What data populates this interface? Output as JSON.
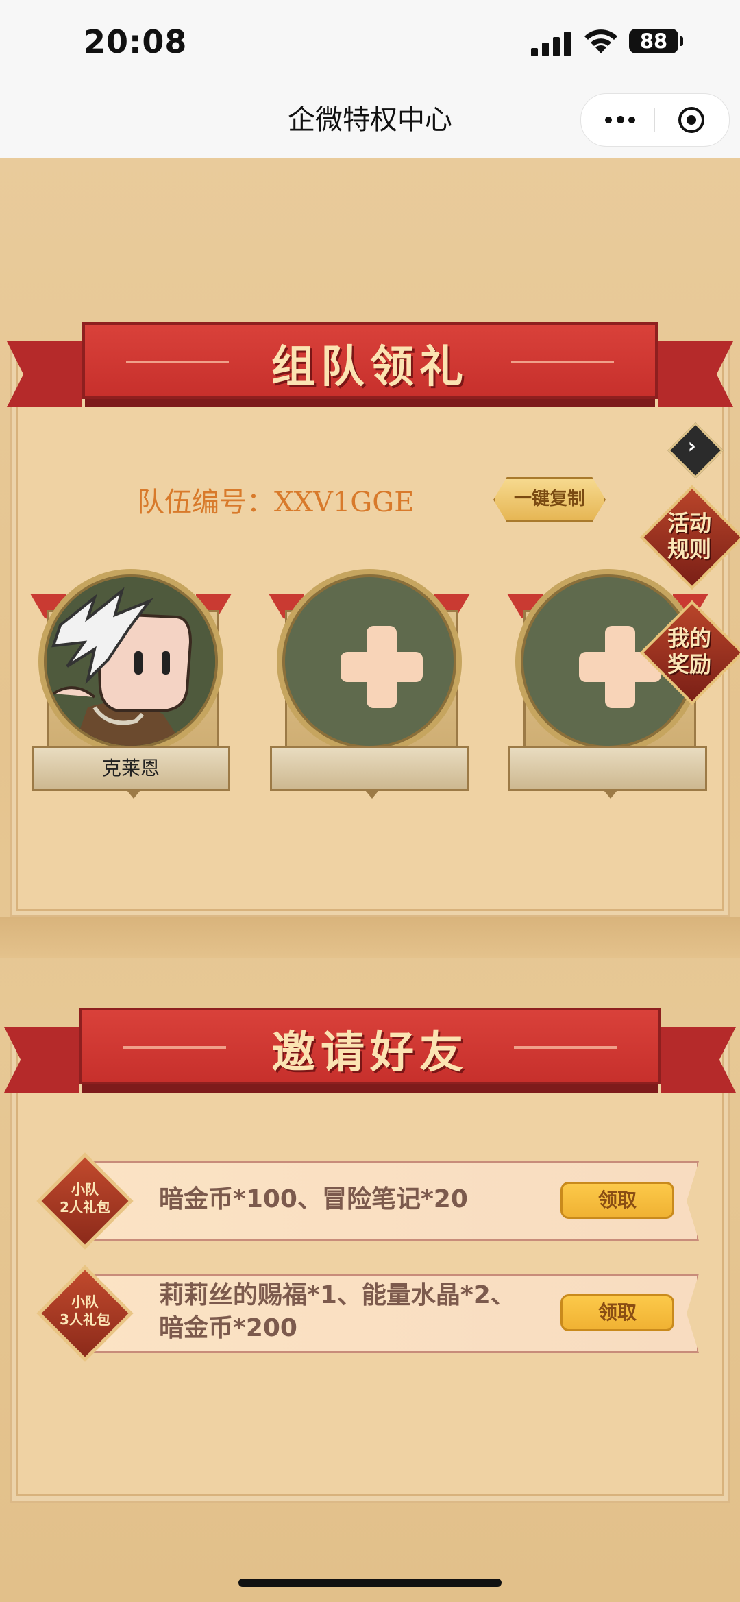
{
  "status_bar": {
    "time": "20:08",
    "battery": "88"
  },
  "nav": {
    "title": "企微特权中心"
  },
  "team_section": {
    "banner_title": "组队领礼",
    "team_number_label": "队伍编号：",
    "team_number_value": "XXV1GGE",
    "copy_button": "一键复制",
    "side_buttons": {
      "rules": "活动\n规则",
      "rewards": "我的\n奖励"
    },
    "members": [
      {
        "name": "克莱恩",
        "filled": true
      },
      {
        "name": "",
        "filled": false
      },
      {
        "name": "",
        "filled": false
      }
    ]
  },
  "invite_section": {
    "banner_title": "邀请好友",
    "rewards": [
      {
        "badge_line1": "小队",
        "badge_line2": "2人礼包",
        "description": "暗金币*100、冒险笔记*20",
        "claim_label": "领取"
      },
      {
        "badge_line1": "小队",
        "badge_line2": "3人礼包",
        "description_line1": "莉莉丝的赐福*1、能量水晶*2、",
        "description_line2": "暗金币*200",
        "claim_label": "领取"
      }
    ]
  },
  "colors": {
    "ribbon_red": "#c7302c",
    "panel_bg": "#efd2a3",
    "team_number_orange": "#d87a2b",
    "claim_yellow": "#f0b233"
  }
}
